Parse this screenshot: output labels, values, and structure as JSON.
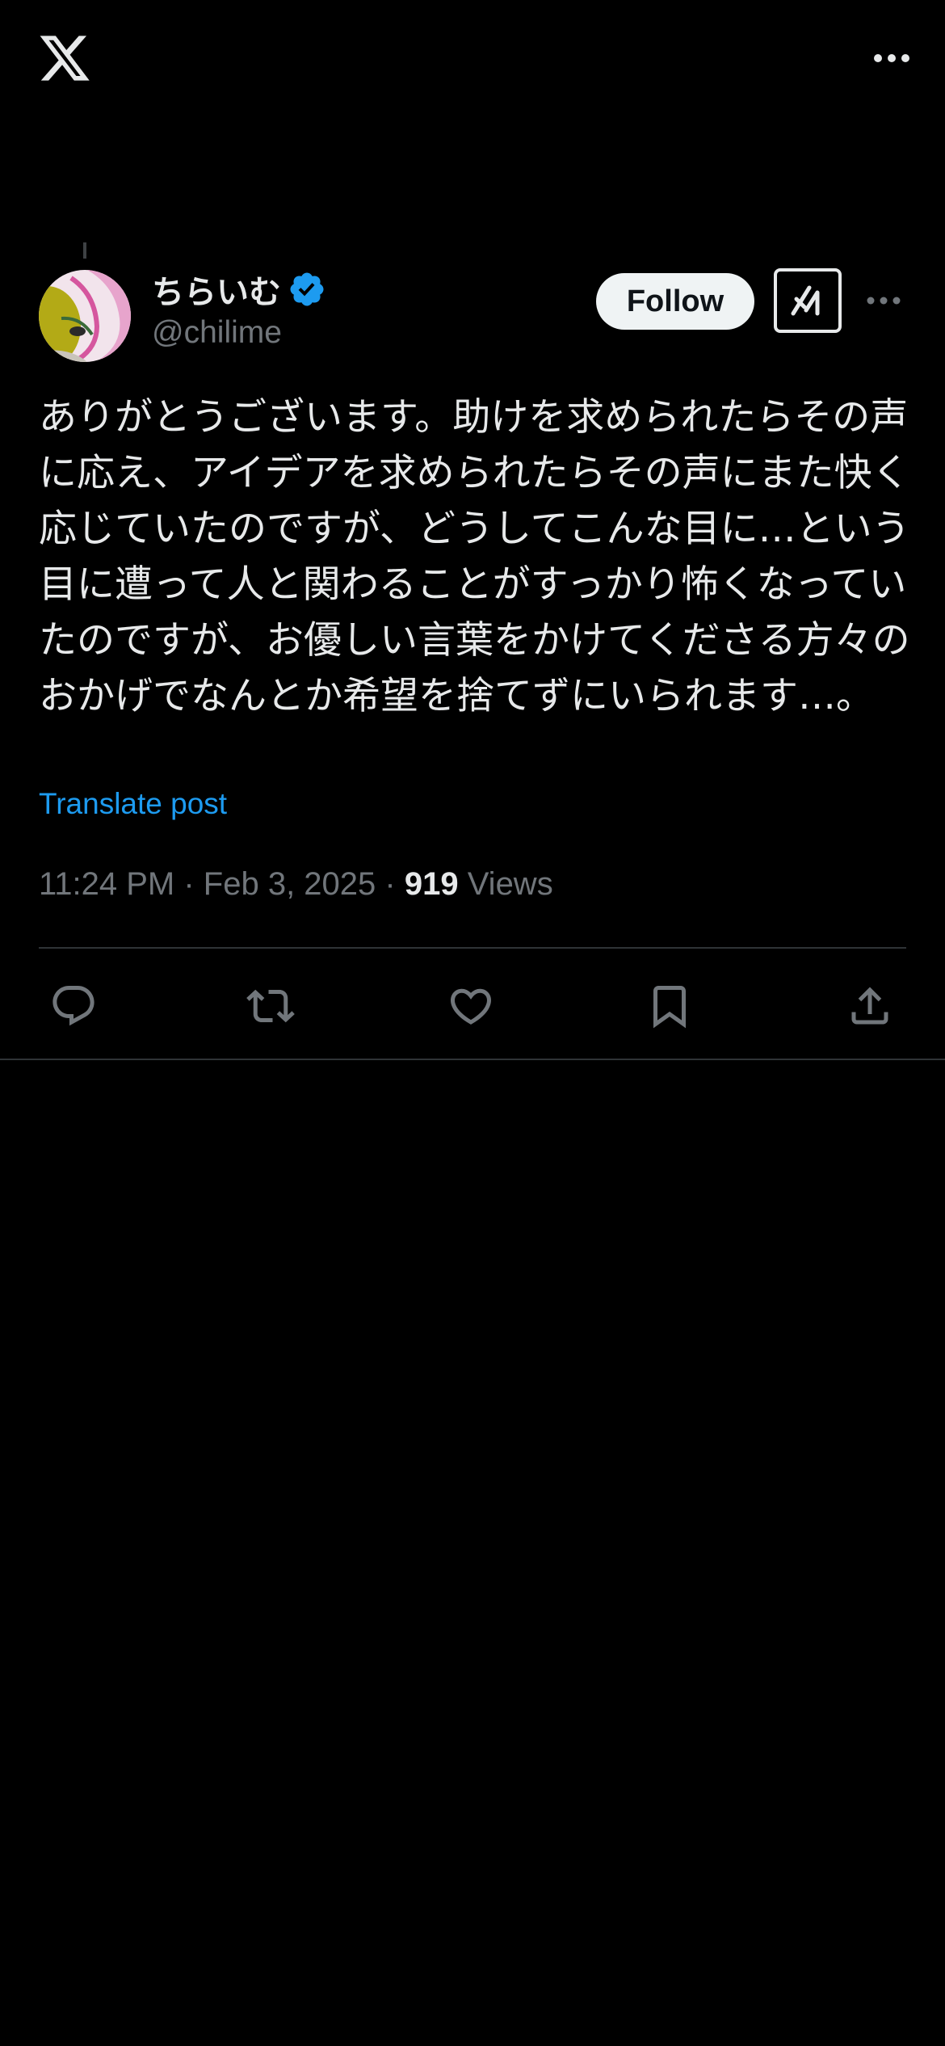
{
  "icons": {
    "logo": "x-logo-icon",
    "more": "more-icon",
    "verified": "verified-badge-icon",
    "grok": "grok-icon",
    "reply": "reply-icon",
    "repost": "repost-icon",
    "like": "like-icon",
    "bookmark": "bookmark-icon",
    "share": "share-icon"
  },
  "colors": {
    "background": "#000000",
    "text": "#e7e9ea",
    "secondary_text": "#71767b",
    "link": "#1d9bf0",
    "verified": "#1d9bf0",
    "follow_bg": "#eff3f4",
    "divider": "#2f3336"
  },
  "post": {
    "author": {
      "display_name": "ちらいむ",
      "handle": "@chilime",
      "verified": true
    },
    "follow_label": "Follow",
    "text": "ありがとうございます。助けを求められたらその声に応え、アイデアを求められたらその声にまた快く応じていたのですが、どうしてこんな目に…という目に遭って人と関わることがすっかり怖くなっていたのですが、お優しい言葉をかけてくださる方々のおかげでなんとか希望を捨てずにいられます…。",
    "translate_label": "Translate post",
    "time": "11:24 PM",
    "date": "Feb 3, 2025",
    "views_count": "919",
    "views_label": "Views"
  }
}
